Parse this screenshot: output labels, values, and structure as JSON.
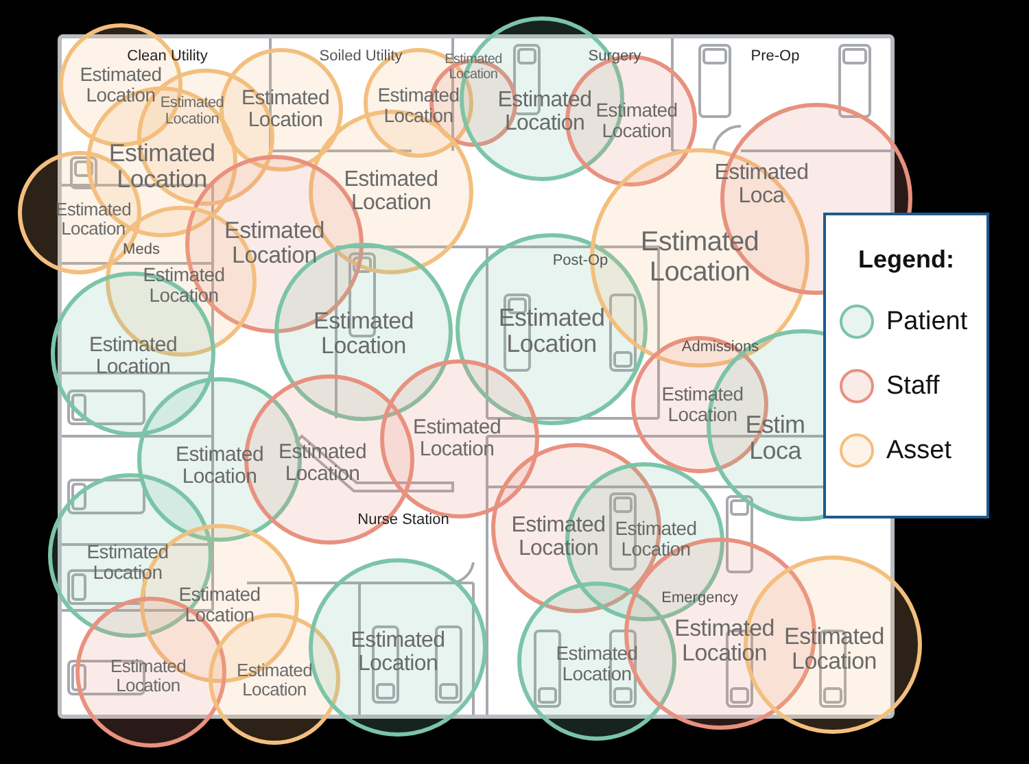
{
  "rooms": [
    {
      "label": "Clean Utility"
    },
    {
      "label": "Soiled Utility"
    },
    {
      "label": "Surgery"
    },
    {
      "label": "Pre-Op"
    },
    {
      "label": "Meds"
    },
    {
      "label": "Post-Op"
    },
    {
      "label": "Admissions"
    },
    {
      "label": "Nurse Station"
    },
    {
      "label": "Emergency"
    }
  ],
  "estimates": [
    {
      "label": "Estimated Location",
      "color": "#f3bf7e"
    },
    {
      "label": "Estimated Location",
      "color": "#f3bf7e"
    },
    {
      "label": "Estimated Location",
      "color": "#f3bf7e"
    },
    {
      "label": "Estimated Location",
      "color": "#f3bf7e"
    },
    {
      "label": "Estimated Location",
      "color": "#f3bf7e"
    },
    {
      "label": "Estimated Location",
      "color": "#f3bf7e"
    },
    {
      "label": "Estimated Location",
      "color": "#e8917f"
    },
    {
      "label": "Estimated Location",
      "color": "#7cc4a8"
    },
    {
      "label": "Estimated Location",
      "color": "#e8917f"
    },
    {
      "label": "Estimated Location",
      "color": "#f3bf7e"
    },
    {
      "label": "Estimated Location",
      "color": "#e8917f"
    },
    {
      "label": "Estimated Location",
      "color": "#f3bf7e"
    },
    {
      "label": "Estimated Location",
      "color": "#7cc4a8"
    },
    {
      "label": "Estimated Location",
      "color": "#7cc4a8"
    },
    {
      "label": "Estimated Location",
      "color": "#7cc4a8"
    },
    {
      "label": "Estimated Location",
      "color": "#f3bf7e"
    },
    {
      "label": "Estimated Loca",
      "color": "#e8917f"
    },
    {
      "label": "Estimated Location",
      "color": "#e8917f"
    },
    {
      "label": "Estim Loca",
      "color": "#7cc4a8"
    },
    {
      "label": "Estimated Location",
      "color": "#7cc4a8"
    },
    {
      "label": "Estimated Location",
      "color": "#e8917f"
    },
    {
      "label": "Estimated Location",
      "color": "#e8917f"
    },
    {
      "label": "Estimated Location",
      "color": "#7cc4a8"
    },
    {
      "label": "Estimated Location",
      "color": "#f3bf7e"
    },
    {
      "label": "Estimated Location",
      "color": "#e8917f"
    },
    {
      "label": "Estimated Location",
      "color": "#7cc4a8"
    },
    {
      "label": "Estimated Location",
      "color": "#e8917f"
    },
    {
      "label": "Estimated Location",
      "color": "#f3bf7e"
    },
    {
      "label": "Estimated Location",
      "color": "#7cc4a8"
    },
    {
      "label": "Estimated Location",
      "color": "#7cc4a8"
    },
    {
      "label": "Estimated Location",
      "color": "#e8917f"
    },
    {
      "label": "Estimated Location",
      "color": "#f3bf7e"
    }
  ],
  "legend": {
    "title": "Legend:",
    "items": [
      {
        "label": "Patient",
        "color": "#7cc4a8"
      },
      {
        "label": "Staff",
        "color": "#e8917f"
      },
      {
        "label": "Asset",
        "color": "#f3bf7e"
      }
    ]
  }
}
